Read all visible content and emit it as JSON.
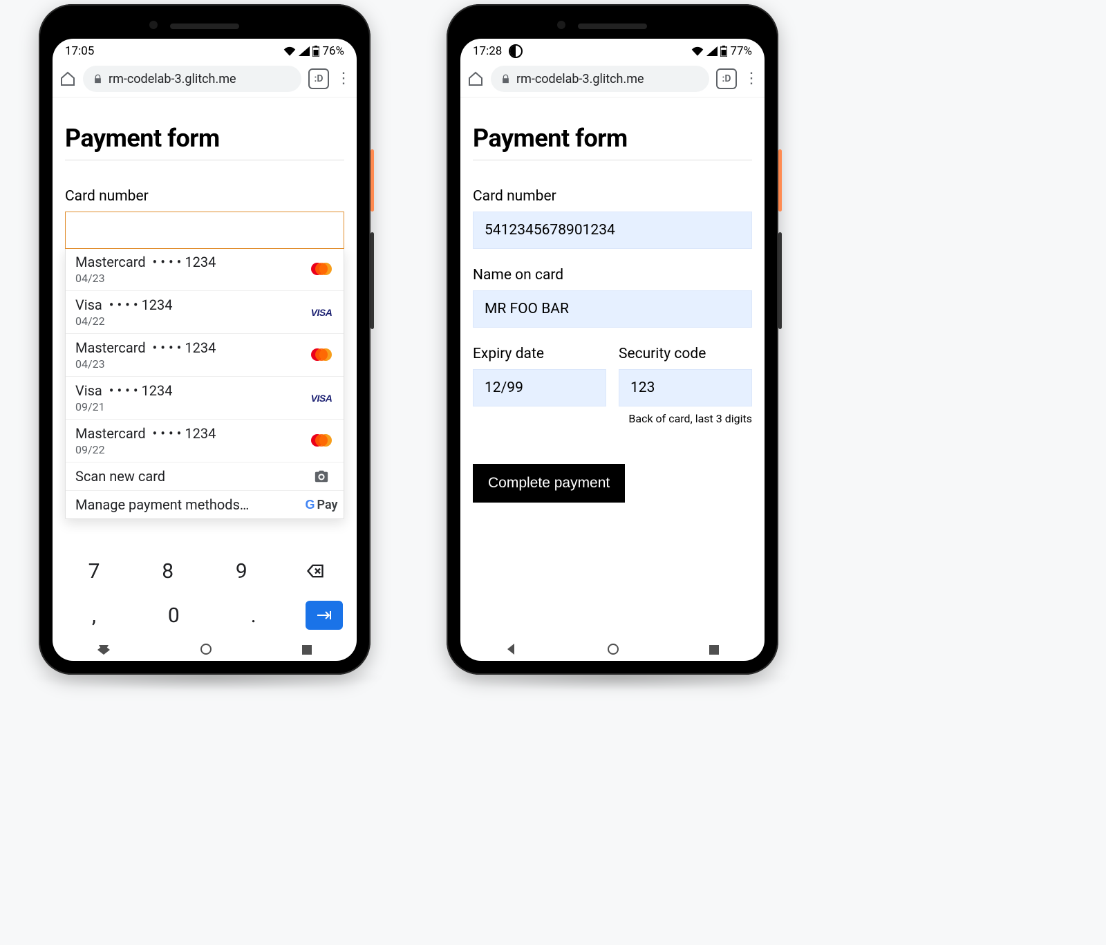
{
  "phone1": {
    "status": {
      "time": "17:05",
      "battery_text": "76%"
    },
    "browser": {
      "url": "rm-codelab-3.glitch.me",
      "tab_label": ":D"
    },
    "page": {
      "title": "Payment form"
    },
    "card_number": {
      "label": "Card number",
      "value": ""
    },
    "autofill": {
      "cards": [
        {
          "brand": "Mastercard",
          "masked": "• • • • 1234",
          "exp": "04/23",
          "logo": "mc"
        },
        {
          "brand": "Visa",
          "masked": "• • • • 1234",
          "exp": "04/22",
          "logo": "visa"
        },
        {
          "brand": "Mastercard",
          "masked": "• • • • 1234",
          "exp": "04/23",
          "logo": "mc"
        },
        {
          "brand": "Visa",
          "masked": "• • • • 1234",
          "exp": "09/21",
          "logo": "visa"
        },
        {
          "brand": "Mastercard",
          "masked": "• • • • 1234",
          "exp": "09/22",
          "logo": "mc"
        }
      ],
      "scan_label": "Scan new card",
      "manage_label": "Manage payment methods…",
      "gpay_text": "Pay"
    },
    "keypad": {
      "k7": "7",
      "k8": "8",
      "k9": "9",
      "kc": ",",
      "k0": "0",
      "kd": "."
    }
  },
  "phone2": {
    "status": {
      "time": "17:28",
      "battery_text": "77%"
    },
    "browser": {
      "url": "rm-codelab-3.glitch.me",
      "tab_label": ":D"
    },
    "page": {
      "title": "Payment form"
    },
    "card_number": {
      "label": "Card number",
      "value": "5412345678901234"
    },
    "name": {
      "label": "Name on card",
      "value": "MR FOO BAR"
    },
    "expiry": {
      "label": "Expiry date",
      "value": "12/99"
    },
    "cvc": {
      "label": "Security code",
      "value": "123",
      "hint": "Back of card, last 3 digits"
    },
    "submit": {
      "label": "Complete payment"
    }
  }
}
